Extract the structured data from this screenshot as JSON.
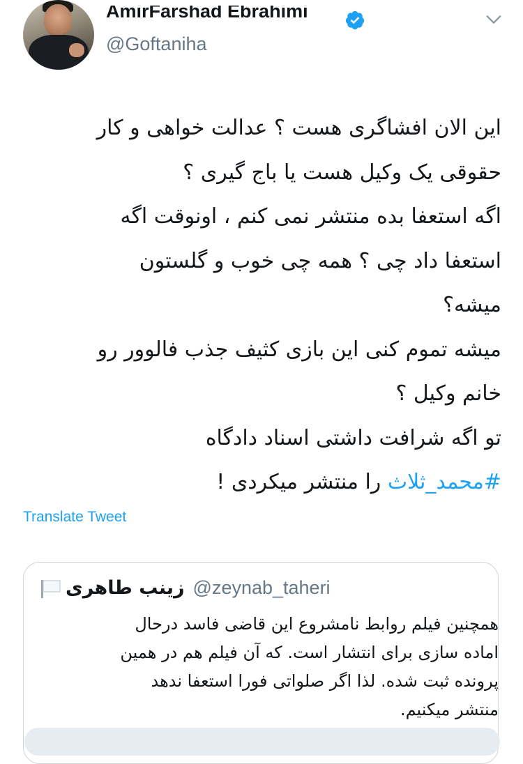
{
  "author": {
    "name": "AmirFarshad Ebrahimi",
    "handle": "@Goftaniha",
    "verified": true,
    "avatar_icon": "profile-photo"
  },
  "menu_icon": "chevron-down-icon",
  "tweet": {
    "lines": [
      "این الان افشاگری هست ؟ عدالت خواهی و کار",
      "حقوقی یک وکیل هست یا باج گیری ؟",
      "اگه استعفا  بده منتشر نمی کنم ، اونوقت اگه",
      "استعفا داد چی ؟ همه چی خوب و گلستون",
      "میشه؟",
      "میشه تموم کنی این بازی کثیف جذب فالوور رو",
      "خانم وکیل ؟",
      "تو اگه شرافت داشتی اسناد دادگاه"
    ],
    "last_line_hashtag": "#محمد_ثلاث",
    "last_line_rest": " را  منتشر میکردی !"
  },
  "translate_label": "Translate Tweet",
  "quoted_tweet": {
    "name": "زینب طاهری",
    "handle": "@zeynab_taheri",
    "flag_icon": "white-flag-icon",
    "lines": [
      "همچنین فیلم روابط نامشروع این قاضی فاسد درحال",
      "اماده سازی برای انتشار است. که آن فیلم هم در همین",
      "پرونده ثبت شده. لذا اگر صلواتی فورا استعفا ندهد",
      "منتشر میکنیم."
    ]
  },
  "colors": {
    "link": "#1da1f2",
    "secondary_text": "#657786",
    "border": "#ccd6dd",
    "text": "#14171a"
  }
}
